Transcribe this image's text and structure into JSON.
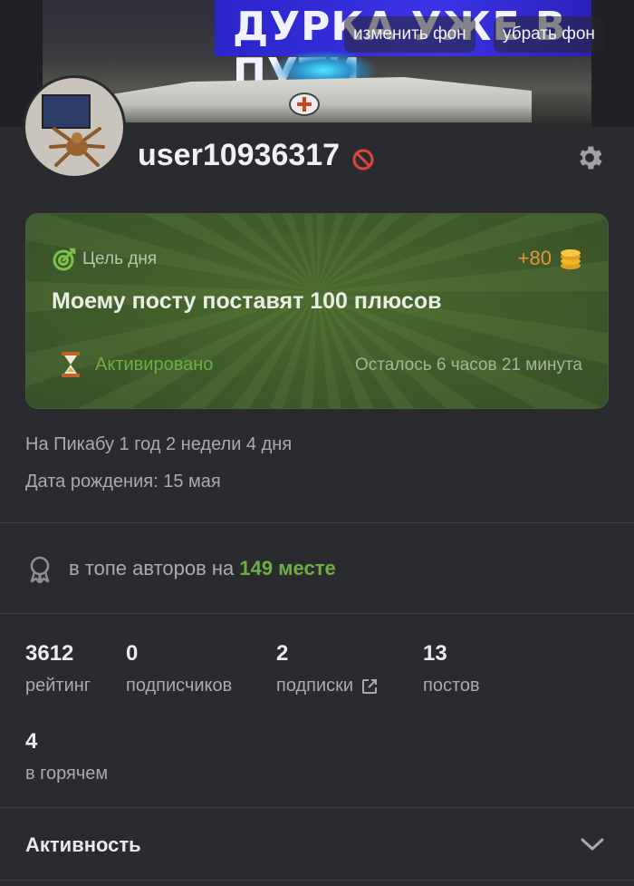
{
  "banner": {
    "sign_text": "ДУРКА УЖЕ В ПУТИ",
    "change_bg_label": "изменить фон",
    "remove_bg_label": "убрать фон"
  },
  "profile": {
    "username": "user10936317",
    "avatar_icon": "avatar",
    "ban_icon": "ban-icon",
    "settings_icon": "gear-icon"
  },
  "goal": {
    "label": "Цель дня",
    "reward": "+80",
    "title": "Моему посту поставят 100 плюсов",
    "status": "Активировано",
    "remaining": "Осталось 6 часов 21 минута"
  },
  "info": {
    "on_pikabu": "На Пикабу 1 год 2 недели 4 дня",
    "birthday": "Дата рождения: 15 мая"
  },
  "rank": {
    "prefix": "в топе авторов на",
    "place": "149 месте"
  },
  "stats": [
    {
      "value": "3612",
      "label": "рейтинг"
    },
    {
      "value": "0",
      "label": "подписчиков"
    },
    {
      "value": "2",
      "label": "подписки"
    },
    {
      "value": "13",
      "label": "постов"
    },
    {
      "value": "4",
      "label": "в горячем"
    }
  ],
  "activity": {
    "label": "Активность"
  },
  "colors": {
    "background": "#2a2b2f",
    "accent_green": "#6fae42",
    "reward_orange": "#e3973d",
    "ban_red": "#e0463e"
  }
}
